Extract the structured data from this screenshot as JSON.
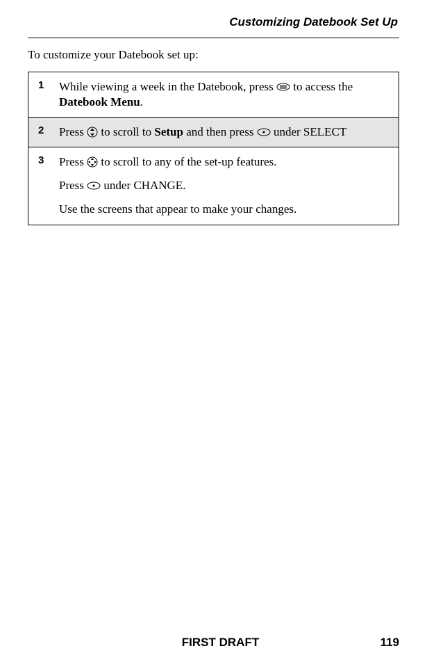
{
  "header": {
    "title": "Customizing Datebook Set Up"
  },
  "intro": "To customize your Datebook set up:",
  "icons": {
    "menu": "menu-key-icon",
    "updown": "up-down-icon",
    "dot": "dot-key-icon",
    "nav": "nav-key-icon",
    "softkey": "softkey-icon"
  },
  "steps": [
    {
      "num": "1",
      "shaded": false,
      "parts": [
        {
          "t": "While viewing a week in the Datebook, press "
        },
        {
          "icon": "menu"
        },
        {
          "t": " to access the "
        },
        {
          "b": "Datebook Menu"
        },
        {
          "t": "."
        }
      ]
    },
    {
      "num": "2",
      "shaded": true,
      "parts": [
        {
          "t": "Press "
        },
        {
          "icon": "updown"
        },
        {
          "t": " to scroll to "
        },
        {
          "b": "Setup"
        },
        {
          "t": " and then press "
        },
        {
          "icon": "dot"
        },
        {
          "t": " under SELECT"
        }
      ]
    },
    {
      "num": "3",
      "shaded": false,
      "paragraphs": [
        [
          {
            "t": "Press "
          },
          {
            "icon": "nav"
          },
          {
            "t": " to scroll to any of the set-up features."
          }
        ],
        [
          {
            "t": "Press "
          },
          {
            "icon": "softkey"
          },
          {
            "t": " under CHANGE."
          }
        ],
        [
          {
            "t": "Use the screens that appear to make your changes."
          }
        ]
      ]
    }
  ],
  "footer": {
    "draft": "FIRST DRAFT",
    "page": "119"
  }
}
